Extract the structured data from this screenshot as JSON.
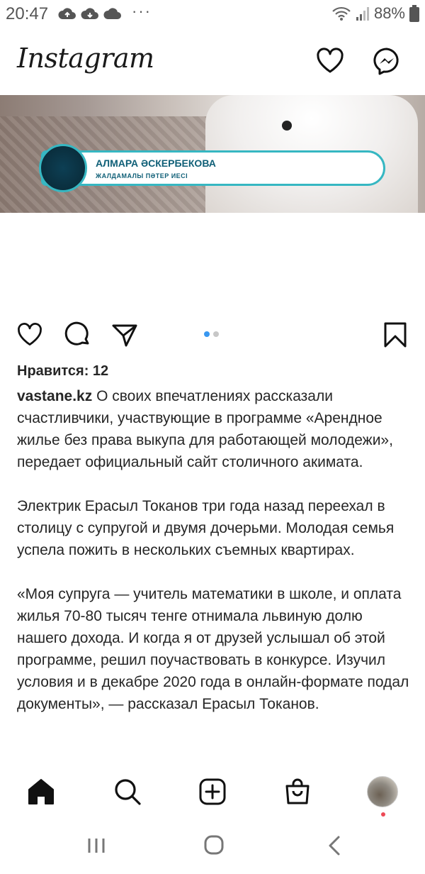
{
  "status_bar": {
    "time": "20:47",
    "dots": "···",
    "battery": "88%",
    "icons": [
      "cloud-upload-icon",
      "cloud-download-icon",
      "cloud-icon",
      "wifi-icon",
      "signal-icon",
      "battery-icon"
    ]
  },
  "header": {
    "logo": "Instagram",
    "actions": [
      "heart-icon",
      "messenger-icon"
    ]
  },
  "post": {
    "media": {
      "overlay_name": "АЛМАРА ӘСКЕРБЕКОВА",
      "overlay_subtitle": "ЖАЛДАМАЛЫ ПӘТЕР ИЕСІ",
      "carousel_index": 1,
      "carousel_count": 2
    },
    "likes": "Нравится: 12",
    "caption": {
      "username": "vastane.kz",
      "paragraph1": "О своих впечатлениях рассказали счастливчики, участвующие в программе «Арендное жилье без права выкупа для работающей молодежи», передает официальный сайт столичного акимата.",
      "paragraph2": "Электрик Ерасыл Токанов три года назад переехал в столицу с супругой и двумя дочерьми. Молодая семья успела пожить в нескольких съемных квартирах.",
      "paragraph3": "«Моя супруга — учитель математики в школе, и оплата жилья 70-80 тысяч тенге отнимала львиную долю нашего дохода. И когда я от друзей услышал об этой программе, решил поучаствовать в конкурсе. Изучил условия и в декабре 2020 года в онлайн-формате подал документы», — рассказал Ерасыл Токанов."
    }
  },
  "colors": {
    "text": "#262626",
    "accent_blue": "#3897f0",
    "overlay_teal": "#36b7c2",
    "notification_red": "#ed4956"
  }
}
